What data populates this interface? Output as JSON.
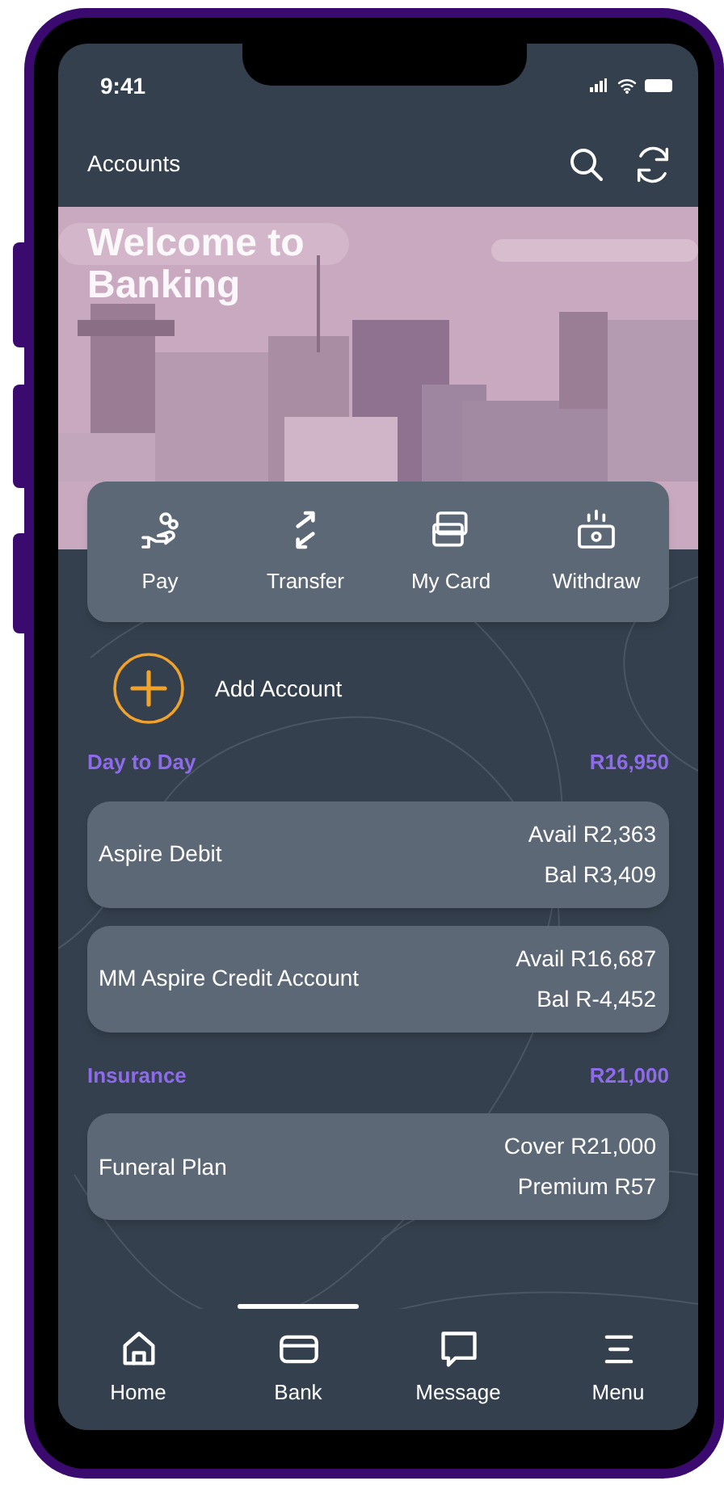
{
  "status_bar": {
    "time": "9:41"
  },
  "header": {
    "title": "Accounts"
  },
  "banner": {
    "title": "Welcome to Banking"
  },
  "quick_actions": [
    {
      "label": "Pay"
    },
    {
      "label": "Transfer"
    },
    {
      "label": "My Card"
    },
    {
      "label": "Withdraw"
    }
  ],
  "add_account": {
    "label": "Add Account"
  },
  "groups": [
    {
      "name": "Day to Day",
      "total": "R16,950",
      "accounts": [
        {
          "name": "Aspire Debit",
          "line_1": "Avail R2,363",
          "line_2": "Bal R3,409"
        },
        {
          "name": "MM Aspire Credit Account",
          "line_1": "Avail R16,687",
          "line_2": "Bal R-4,452"
        }
      ]
    },
    {
      "name": "Insurance",
      "total": "R21,000",
      "accounts": [
        {
          "name": "Funeral Plan",
          "line_1": "Cover R21,000",
          "line_2": "Premium R57"
        }
      ]
    }
  ],
  "nav": [
    {
      "label": "Home",
      "selected": false
    },
    {
      "label": "Bank",
      "selected": true
    },
    {
      "label": "Message",
      "selected": false
    },
    {
      "label": "Menu",
      "selected": false
    }
  ]
}
